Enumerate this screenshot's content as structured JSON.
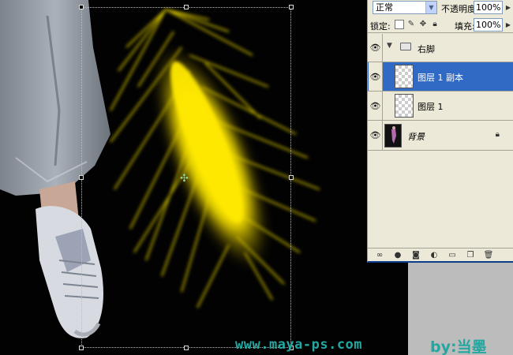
{
  "palette": {
    "blend_mode": "正常",
    "opacity_label": "不透明度:",
    "opacity_value": "100%",
    "lock_label": "锁定:",
    "fill_label": "填充:",
    "fill_value": "100%",
    "layers": [
      {
        "name": "右脚",
        "kind": "group"
      },
      {
        "name": "图层 1 副本",
        "kind": "layer",
        "selected": true
      },
      {
        "name": "图层 1",
        "kind": "layer"
      },
      {
        "name": "背景",
        "kind": "background",
        "locked": true
      }
    ],
    "bottom_icons": [
      "link-icon",
      "fx-icon",
      "mask-icon",
      "adjustment-icon",
      "new-group-icon",
      "new-layer-icon",
      "trash-icon"
    ]
  },
  "watermark": {
    "url": "www.maya-ps.com",
    "author": "by:当墨"
  },
  "colors": {
    "flame_yellow": "#ffe600",
    "selection_blue": "#316ac5",
    "watermark_teal": "#23a7a0",
    "palette_bg": "#ece9d8"
  }
}
